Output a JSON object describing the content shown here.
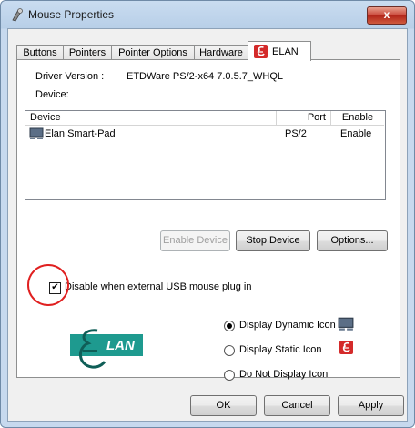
{
  "window": {
    "title": "Mouse Properties",
    "close_label": "x"
  },
  "tabs": [
    {
      "label": "Buttons",
      "active": false
    },
    {
      "label": "Pointers",
      "active": false
    },
    {
      "label": "Pointer Options",
      "active": false
    },
    {
      "label": "Hardware",
      "active": false
    },
    {
      "label": "ELAN",
      "active": true
    }
  ],
  "driver": {
    "label": "Driver Version :",
    "value": "ETDWare PS/2-x64 7.0.5.7_WHQL"
  },
  "device_label": "Device:",
  "device_list": {
    "columns": [
      "Device",
      "Port",
      "Enable"
    ],
    "rows": [
      {
        "device": "Elan Smart-Pad",
        "port": "PS/2",
        "enable": "Enable"
      }
    ]
  },
  "buttons": {
    "enable_device": "Enable Device",
    "stop_device": "Stop Device",
    "options": "Options..."
  },
  "disable_option": {
    "label": "Disable when external USB mouse plug in",
    "checked": true
  },
  "logo": {
    "text": "LAN"
  },
  "icon_options": [
    {
      "label": "Display Dynamic Icon",
      "selected": true
    },
    {
      "label": "Display Static Icon",
      "selected": false
    },
    {
      "label": "Do Not Display Icon",
      "selected": false
    }
  ],
  "dialog_buttons": {
    "ok": "OK",
    "cancel": "Cancel",
    "apply": "Apply"
  },
  "colors": {
    "accent_red": "#e02020",
    "logo_teal": "#1e9a8f"
  }
}
